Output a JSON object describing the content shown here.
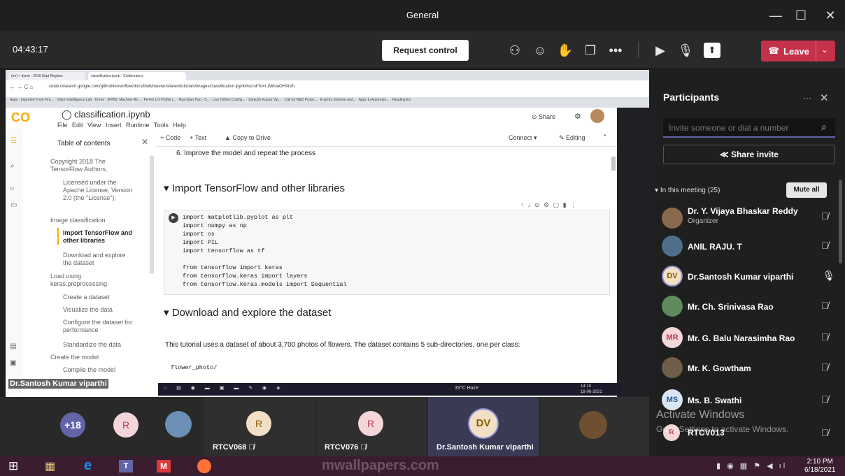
{
  "window": {
    "title": "General",
    "minimize": "—",
    "maximize": "☐",
    "close": "✕"
  },
  "toolbar": {
    "timer": "04:43:17",
    "request_control": "Request control",
    "leave": "Leave",
    "more": "•••"
  },
  "browser": {
    "tabs": [
      "(en) > dynm - 2019 Sept Regions",
      "classification.ipynb - Colaboratory"
    ],
    "url": "colab.research.google.com/github/tensorflow/docs/blob/master/site/en/tutorials/images/classification.ipynb#scrollTo=L1WtoaOHVrVh",
    "bookmarks": [
      "Apps",
      "Imported From Fire...",
      "Vision Intelligence Lab",
      "Home",
      "M-RIS: Machine Re...",
      "Fe-Fei Li's Profile |...",
      "Hua-Qian Hao - S...",
      "Live Online Coding...",
      "Santosh Kumar Vip...",
      "Call for R&D Propo...",
      "E-prints Scheme and...",
      "Apps to Automate...",
      "Reading list"
    ]
  },
  "colab": {
    "logo": "CO",
    "filename": "classification.ipynb",
    "menu": [
      "File",
      "Edit",
      "View",
      "Insert",
      "Runtime",
      "Tools",
      "Help"
    ],
    "share": "Share",
    "add_code": "+ Code",
    "add_text": "+ Text",
    "copy_drive": "Copy to Drive",
    "connect": "Connect",
    "editing": "Editing",
    "toc_title": "Table of contents",
    "toc": [
      "Copyright 2018 The TensorFlow Authors.",
      "Licensed under the Apache License, Version 2.0 (the \"License\");",
      "Image classification",
      "Import TensorFlow and other libraries",
      "Download and explore the dataset",
      "Load using keras.preprocessing",
      "Create a dataset",
      "Visualize the data",
      "Configure the dataset for performance",
      "Standardize the data",
      "Create the model",
      "Compile the model"
    ],
    "step6": "6. Improve the model and repeat the process",
    "h_import": "Import TensorFlow and other libraries",
    "code_lines": [
      "import matplotlib.pyplot as plt",
      "import numpy as np",
      "import os",
      "import PIL",
      "import tensorflow as tf",
      "",
      "from tensorflow import keras",
      "from tensorflow.keras import layers",
      "from tensorflow.keras.models import Sequential"
    ],
    "h_download": "Download and explore the dataset",
    "dataset_text": "This tutorial uses a dataset of about 3,700 photos of flowers. The dataset contains 5 sub-directories, one per class:",
    "flower_code": "flower_photo/"
  },
  "presenter_label": "Dr.Santosh Kumar viparthi",
  "inner_taskbar": {
    "weather": "33°C Haze",
    "time": "14:10",
    "date": "18-06-2021"
  },
  "participants": {
    "title": "Participants",
    "invite_placeholder": "Invite someone or dial a number",
    "share_invite": "Share invite",
    "in_meeting": "In this meeting (25)",
    "mute_all": "Mute all",
    "list": [
      {
        "name": "Dr. Y. Vijaya Bhaskar Reddy",
        "role": "Organizer",
        "initials": ""
      },
      {
        "name": "ANIL RAJU. T",
        "role": "",
        "initials": ""
      },
      {
        "name": "Dr.Santosh Kumar viparthi",
        "role": "",
        "initials": "DV"
      },
      {
        "name": "Mr. Ch. Srinivasa Rao",
        "role": "",
        "initials": ""
      },
      {
        "name": "Mr. G. Balu Narasimha Rao",
        "role": "",
        "initials": "MR"
      },
      {
        "name": "Mr. K. Gowtham",
        "role": "",
        "initials": ""
      },
      {
        "name": "Ms. B. Swathi",
        "role": "",
        "initials": "MS"
      },
      {
        "name": "RTCV013",
        "role": "",
        "initials": "R"
      }
    ]
  },
  "gallery": {
    "overflow": "+18",
    "r1": "R",
    "rtcv068_initial": "R",
    "rtcv068": "RTCV068",
    "rtcv076_initial": "R",
    "rtcv076": "RTCV076",
    "dv_initials": "DV",
    "dv_name": "Dr.Santosh Kumar viparthi"
  },
  "watermark": {
    "line1": "Activate Windows",
    "line2": "Go to Settings to activate Windows.",
    "site": "mwallpapers.com"
  },
  "taskbar": {
    "time": "2:10 PM",
    "date": "6/18/2021"
  },
  "colors": {
    "leave": "#c4314b",
    "teams_purple": "#6264a7",
    "dv_ring": "#8b8fcf"
  }
}
